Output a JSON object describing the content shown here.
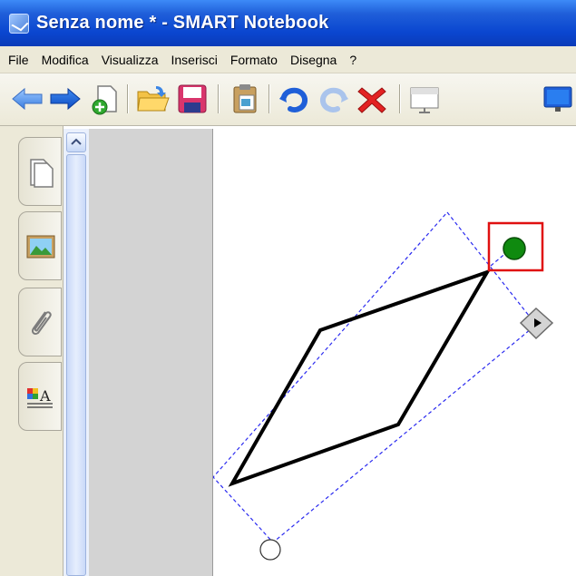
{
  "window": {
    "title": "Senza nome * - SMART Notebook"
  },
  "menu": {
    "items": [
      "File",
      "Modifica",
      "Visualizza",
      "Inserisci",
      "Formato",
      "Disegna",
      "?"
    ]
  },
  "toolbar": {
    "buttons": [
      "back-arrow-icon",
      "forward-arrow-icon",
      "add-page-icon",
      "open-folder-icon",
      "save-disk-icon",
      "paste-icon",
      "undo-icon",
      "redo-icon",
      "delete-icon",
      "screen-shade-icon",
      "display-icon"
    ]
  },
  "sidebar": {
    "tabs": [
      "page-sorter-icon",
      "gallery-icon",
      "attachments-icon",
      "properties-icon"
    ]
  },
  "colors": {
    "title_bar": "#0a46d0",
    "selection_dash": "#2a2af0",
    "rotate_handle": "#0f8a0f",
    "highlight_box": "#e01010",
    "shape_stroke": "#000000"
  },
  "canvas": {
    "shape": "parallelogram",
    "selected": true
  }
}
